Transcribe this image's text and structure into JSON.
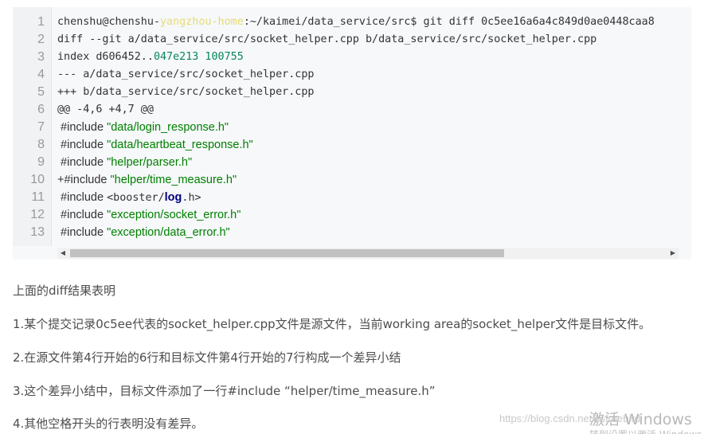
{
  "code": {
    "line_numbers": [
      "1",
      "2",
      "3",
      "4",
      "5",
      "6",
      "7",
      "8",
      "9",
      "10",
      "11",
      "12",
      "13"
    ],
    "line1": {
      "user": "chenshu@chenshu-",
      "host": "yangzhou-home",
      "rest": ":~/kaimei/data_service/src$ git diff 0c5ee16a6a4c849d0ae0448caa8"
    },
    "line2": "diff --git a/data_service/src/socket_helper.cpp b/data_service/src/socket_helper.cpp",
    "line3": {
      "prefix": "index d606452..",
      "hash": "047e213",
      "mode": " 100755"
    },
    "line4": "--- a/data_service/src/socket_helper.cpp",
    "line5": "+++ b/data_service/src/socket_helper.cpp",
    "line6": "@@ -4,6 +4,7 @@",
    "line7": {
      "prefix": " #include ",
      "str": "\"data/login_response.h\""
    },
    "line8": {
      "prefix": " #include ",
      "str": "\"data/heartbeat_response.h\""
    },
    "line9": {
      "prefix": " #include ",
      "str": "\"helper/parser.h\""
    },
    "line10": {
      "prefix": "+#include ",
      "str": "\"helper/time_measure.h\""
    },
    "line11": {
      "prefix": " #include ",
      "open": "<booster/",
      "kw": "log",
      "close": ".h>"
    },
    "line12": {
      "prefix": " #include ",
      "str": "\"exception/socket_error.h\""
    },
    "line13": {
      "prefix": " #include ",
      "str": "\"exception/data_error.h\""
    }
  },
  "scrollbar": {
    "left_arrow": "◀",
    "right_arrow": "▶"
  },
  "article": {
    "p0": "上面的diff结果表明",
    "p1": "1.某个提交记录0c5ee代表的socket_helper.cpp文件是源文件，当前working area的socket_helper文件是目标文件。",
    "p2": "2.在源文件第4行开始的6行和目标文件第4行开始的7行构成一个差异小结",
    "p3": "3.这个差异小结中，目标文件添加了一行#include  “helper/time_measure.h”",
    "p4": "4.其他空格开头的行表明没有差异。"
  },
  "watermark": {
    "url": "https://blog.csdn.net/csfreebird",
    "activate": "激活 Windows",
    "activate_sub": "转到设置以激活 Windows。"
  }
}
